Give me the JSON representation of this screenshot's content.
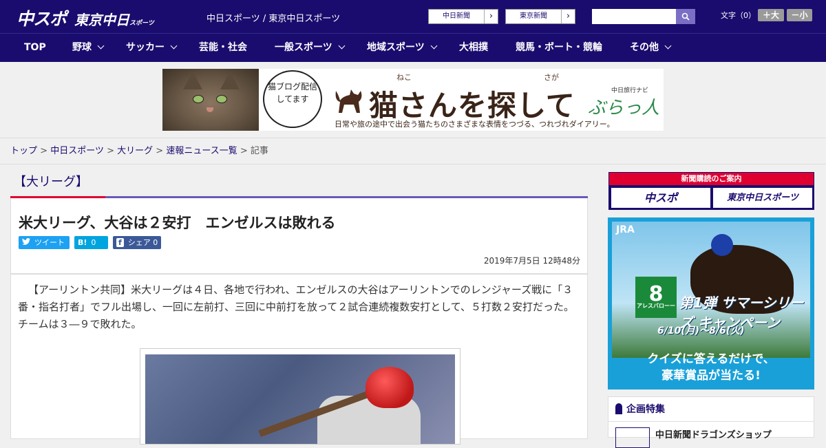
{
  "header": {
    "logo_primary": "中スポ",
    "logo_secondary": "東京中日",
    "logo_secondary_small": "スポーツ",
    "tagline": "中日スポーツ / 東京中日スポーツ",
    "buttons": [
      {
        "label": "中日新聞",
        "arrow": "›"
      },
      {
        "label": "東京新聞",
        "arrow": "›"
      }
    ],
    "search_placeholder": "",
    "font_size_label": "文字（0）",
    "font_larger": "＋大",
    "font_smaller": "－小"
  },
  "nav": {
    "items": [
      {
        "label": "TOP",
        "dropdown": false
      },
      {
        "label": "野球",
        "dropdown": true
      },
      {
        "label": "サッカー",
        "dropdown": true
      },
      {
        "label": "芸能・社会",
        "dropdown": false
      },
      {
        "label": "一般スポーツ",
        "dropdown": true
      },
      {
        "label": "地域スポーツ",
        "dropdown": true
      },
      {
        "label": "大相撲",
        "dropdown": false
      },
      {
        "label": "競馬・ボート・競輪",
        "dropdown": false
      },
      {
        "label": "その他",
        "dropdown": true
      }
    ]
  },
  "banner": {
    "bubble_text": "猫ブログ配信してます",
    "title": "猫さんを探して",
    "ruby_neko": "ねこ",
    "ruby_saga": "さが",
    "subtitle": "日常や旅の途中で出会う猫たちのさまざまな表情をつづる、つれづれダイアリー。",
    "brand_small": "中日旅行ナビ",
    "brand": "ぶらっ人"
  },
  "breadcrumb": {
    "items": [
      "トップ",
      "中日スポーツ",
      "大リーグ",
      "速報ニュース一覧"
    ],
    "separator": ">",
    "current": "記事"
  },
  "article": {
    "category": "【大リーグ】",
    "title": "米大リーグ、大谷は２安打　エンゼルスは敗れる",
    "share": {
      "tweet": "ツイート",
      "hatena_icon": "B!",
      "hatena_count": "0",
      "facebook_icon": "f",
      "facebook_label": "シェア",
      "facebook_count": "0"
    },
    "date": "2019年7月5日 12時48分",
    "lead": "【アーリントン共同】米大リーグは４日、各地で行われ、エンゼルスの大谷はアーリントンでのレンジャーズ戦に「３番・指名打者」でフル出場し、一回に左前打、三回に中前打を放って２試合連続複数安打として、５打数２安打だった。チームは３―９で敗れた。"
  },
  "sidebar": {
    "subscribe_title": "新聞購読のご案内",
    "subscribe_buttons": [
      "中スポ",
      "東京中日スポーツ"
    ],
    "jra_ad": {
      "logo": "JRA",
      "number": "8",
      "number_caption": "アレスバローー",
      "campaign": "第1弾 サマーシリーズ キャンペーン",
      "dates": "6/10(月)～8/6(火)",
      "quiz_line1": "クイズに答えるだけで、",
      "quiz_line2": "豪華賞品が当たる!"
    },
    "feature_title": "企画特集",
    "feature_item": "中日新聞ドラゴンズショップ"
  },
  "colors": {
    "brand_navy": "#1a0c6e",
    "accent_red": "#e00030",
    "accent_purple": "#6a58b8",
    "twitter": "#1da1f2",
    "hatena": "#00a4de",
    "facebook": "#3b5998"
  }
}
